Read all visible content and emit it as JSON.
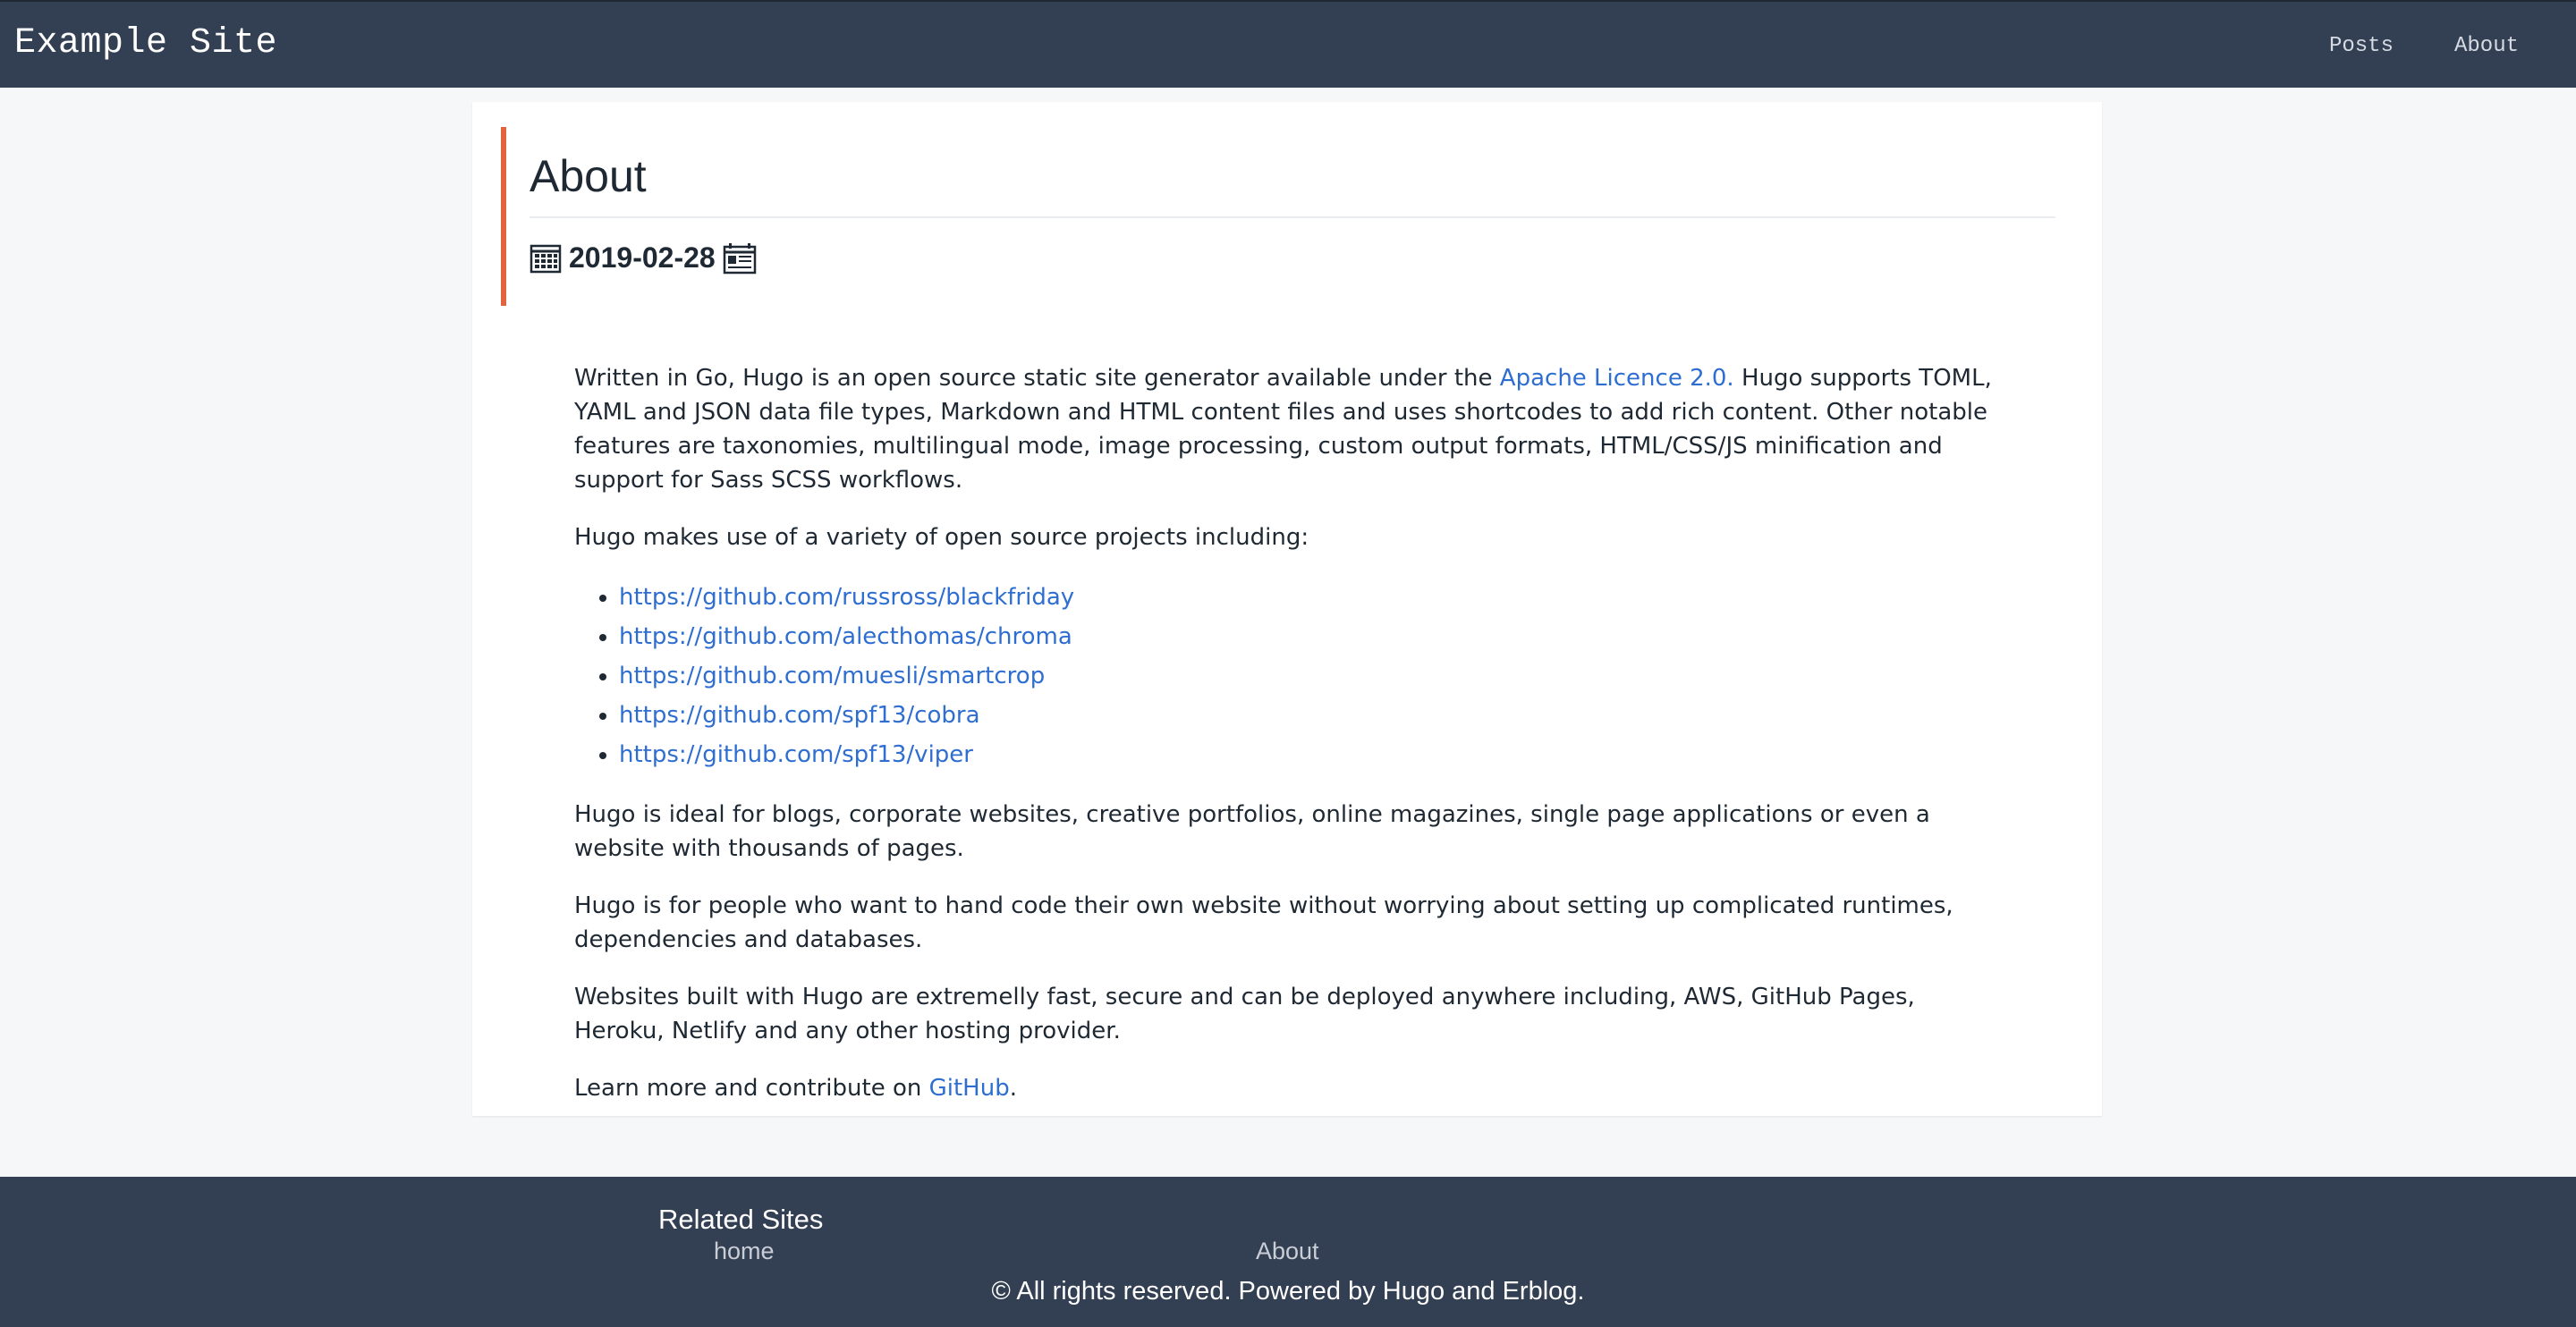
{
  "header": {
    "brand": "Example Site",
    "nav": [
      {
        "label": "Posts"
      },
      {
        "label": "About"
      }
    ]
  },
  "post": {
    "title": "About",
    "date": "2019-02-28",
    "icons": {
      "date": "calendar-icon",
      "meta": "news-icon"
    },
    "intro_before_link": "Written in Go, Hugo is an open source static site generator available under the ",
    "intro_link": "Apache Licence 2.0.",
    "intro_after_link": " Hugo supports TOML, YAML and JSON data file types, Markdown and HTML content files and uses shortcodes to add rich content. Other notable features are taxonomies, multilingual mode, image processing, custom output formats, HTML/CSS/JS minification and support for Sass SCSS workflows.",
    "projects_intro": "Hugo makes use of a variety of open source projects including:",
    "projects": [
      "https://github.com/russross/blackfriday",
      "https://github.com/alecthomas/chroma",
      "https://github.com/muesli/smartcrop",
      "https://github.com/spf13/cobra",
      "https://github.com/spf13/viper"
    ],
    "paragraph_ideal": "Hugo is ideal for blogs, corporate websites, creative portfolios, online magazines, single page applications or even a website with thousands of pages.",
    "paragraph_people": "Hugo is for people who want to hand code their own website without worrying about setting up complicated runtimes, dependencies and databases.",
    "paragraph_fast": "Websites built with Hugo are extremelly fast, secure and can be deployed anywhere including, AWS, GitHub Pages, Heroku, Netlify and any other hosting provider.",
    "learn_more_before": "Learn more and contribute on ",
    "learn_more_link": "GitHub",
    "learn_more_after": "."
  },
  "footer": {
    "heading": "Related Sites",
    "home_link": "home",
    "about_link": "About",
    "copyright": "© All rights reserved. Powered by Hugo and Erblog."
  },
  "colors": {
    "header_bg": "#333f52",
    "accent_border": "#e2643f",
    "link": "#2f6ed1",
    "page_bg": "#f6f7f9"
  }
}
